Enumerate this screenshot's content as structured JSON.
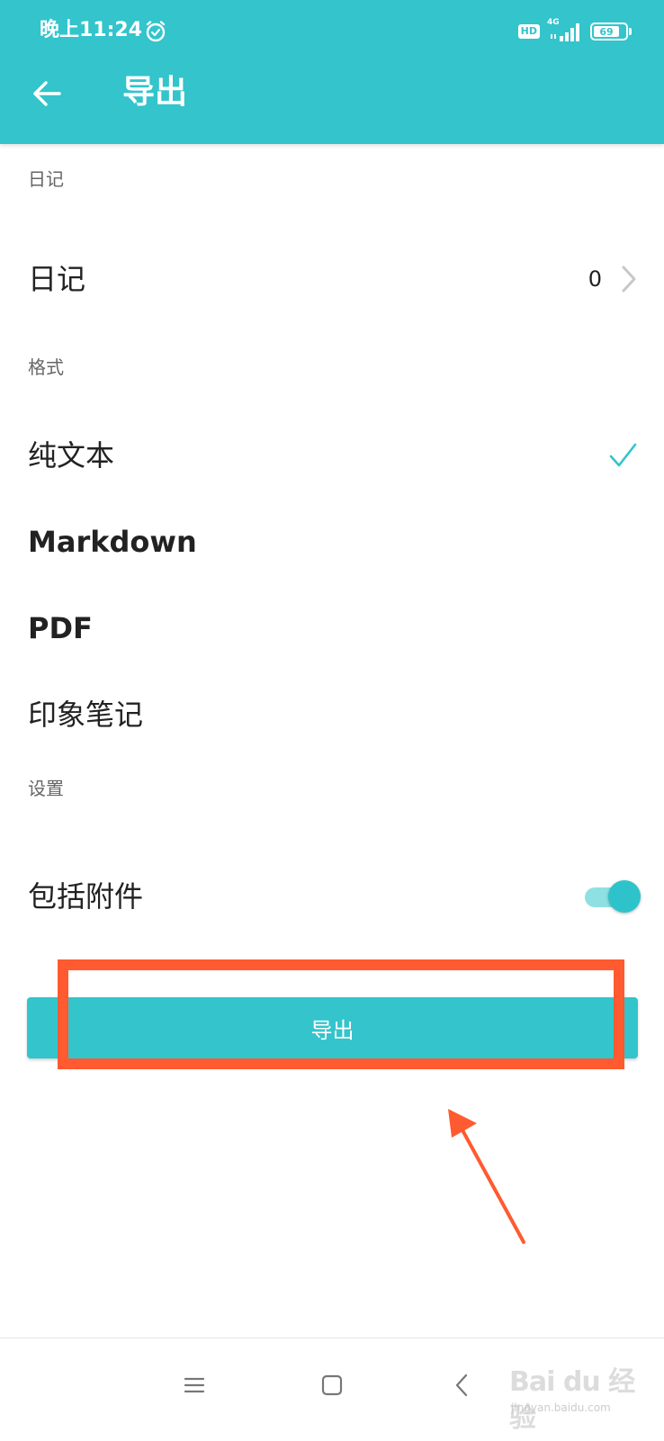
{
  "status_bar": {
    "time": "晚上11:24",
    "hd": "HD",
    "network": "4G",
    "battery": "69"
  },
  "app_bar": {
    "title": "导出",
    "back_icon": "arrow-left-icon"
  },
  "sections": {
    "diary": {
      "header": "日记",
      "item_label": "日记",
      "item_count": "0"
    },
    "format": {
      "header": "格式",
      "options": [
        {
          "label": "纯文本",
          "selected": true
        },
        {
          "label": "Markdown",
          "selected": false
        },
        {
          "label": "PDF",
          "selected": false
        },
        {
          "label": "印象笔记",
          "selected": false
        }
      ]
    },
    "settings": {
      "header": "设置",
      "include_attachments_label": "包括附件",
      "include_attachments_on": true
    }
  },
  "export_button": {
    "label": "导出"
  },
  "annotation": {
    "color": "#ff5a30"
  },
  "nav_bar": {
    "icons": [
      "menu-icon",
      "home-icon",
      "back-icon"
    ]
  },
  "watermark": {
    "text": "Bai du 经验",
    "sub": "jingyan.baidu.com"
  },
  "colors": {
    "accent": "#33c4cc",
    "toggle_track": "#8fe0e3",
    "annotation": "#ff5a30"
  }
}
